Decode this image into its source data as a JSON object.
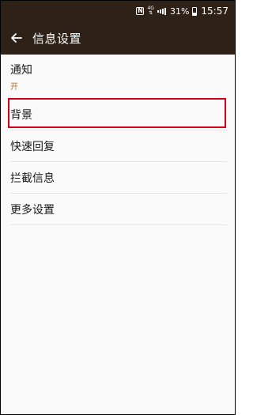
{
  "statusbar": {
    "nfc": "N",
    "network": "4G",
    "battery_text": "31%",
    "time": "15:57"
  },
  "appbar": {
    "title": "信息设置",
    "back_icon": "arrow-left-icon"
  },
  "settings": {
    "items": [
      {
        "label": "通知",
        "value": "开"
      },
      {
        "label": "背景"
      },
      {
        "label": "快速回复"
      },
      {
        "label": "拦截信息"
      },
      {
        "label": "更多设置"
      }
    ]
  },
  "colors": {
    "appbar_bg": "#2e2218",
    "accent_value": "#b0723a",
    "highlight": "#d4001a"
  }
}
